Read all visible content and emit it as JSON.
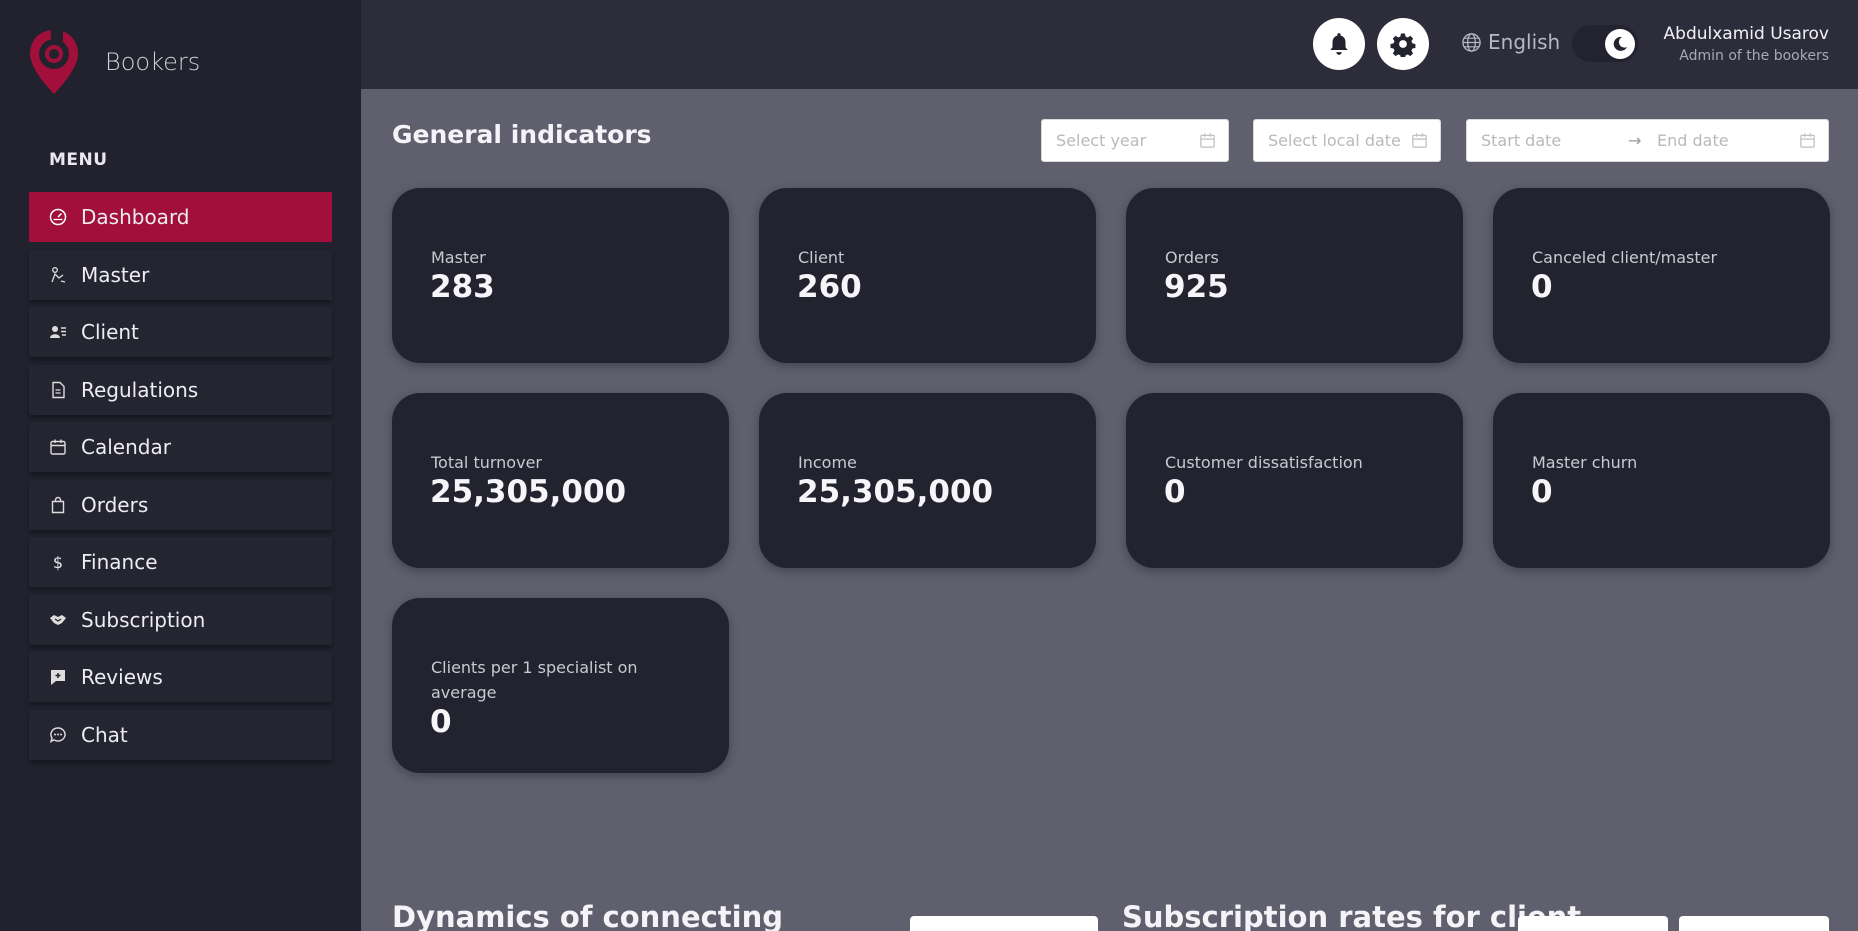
{
  "app": {
    "name": "Bookers",
    "brand_color": "#a30f3b"
  },
  "sidebar": {
    "menu_title": "MENU",
    "items": [
      {
        "label": "Dashboard",
        "icon": "dashboard-gauge-icon",
        "active": true
      },
      {
        "label": "Master",
        "icon": "master-icon",
        "active": false
      },
      {
        "label": "Client",
        "icon": "client-card-icon",
        "active": false
      },
      {
        "label": "Regulations",
        "icon": "document-icon",
        "active": false
      },
      {
        "label": "Calendar",
        "icon": "calendar-icon",
        "active": false
      },
      {
        "label": "Orders",
        "icon": "shopping-bag-icon",
        "active": false
      },
      {
        "label": "Finance",
        "icon": "dollar-icon",
        "active": false
      },
      {
        "label": "Subscription",
        "icon": "handshake-icon",
        "active": false
      },
      {
        "label": "Reviews",
        "icon": "review-plus-icon",
        "active": false
      },
      {
        "label": "Chat",
        "icon": "chat-bubble-icon",
        "active": false
      }
    ]
  },
  "header": {
    "language": "English",
    "theme": "dark",
    "user": {
      "name": "Abdulxamid Usarov",
      "role": "Admin of the bookers"
    }
  },
  "main": {
    "title": "General indicators",
    "filters": {
      "year_placeholder": "Select year",
      "local_date_placeholder": "Select local date",
      "start_placeholder": "Start date",
      "end_placeholder": "End date",
      "range_separator": "→"
    },
    "cards": [
      {
        "label": "Master",
        "value": "283"
      },
      {
        "label": "Client",
        "value": "260"
      },
      {
        "label": "Orders",
        "value": "925"
      },
      {
        "label": "Canceled client/master",
        "value": "0"
      },
      {
        "label": "Total turnover",
        "value": "25,305,000"
      },
      {
        "label": "Income",
        "value": "25,305,000"
      },
      {
        "label": "Customer dissatisfaction",
        "value": "0"
      },
      {
        "label": "Master churn",
        "value": "0"
      },
      {
        "label": "Clients per 1 specialist on average",
        "value": "0"
      }
    ],
    "sections": [
      {
        "title": "Dynamics of connecting"
      },
      {
        "title": "Subscription rates for client"
      }
    ]
  }
}
